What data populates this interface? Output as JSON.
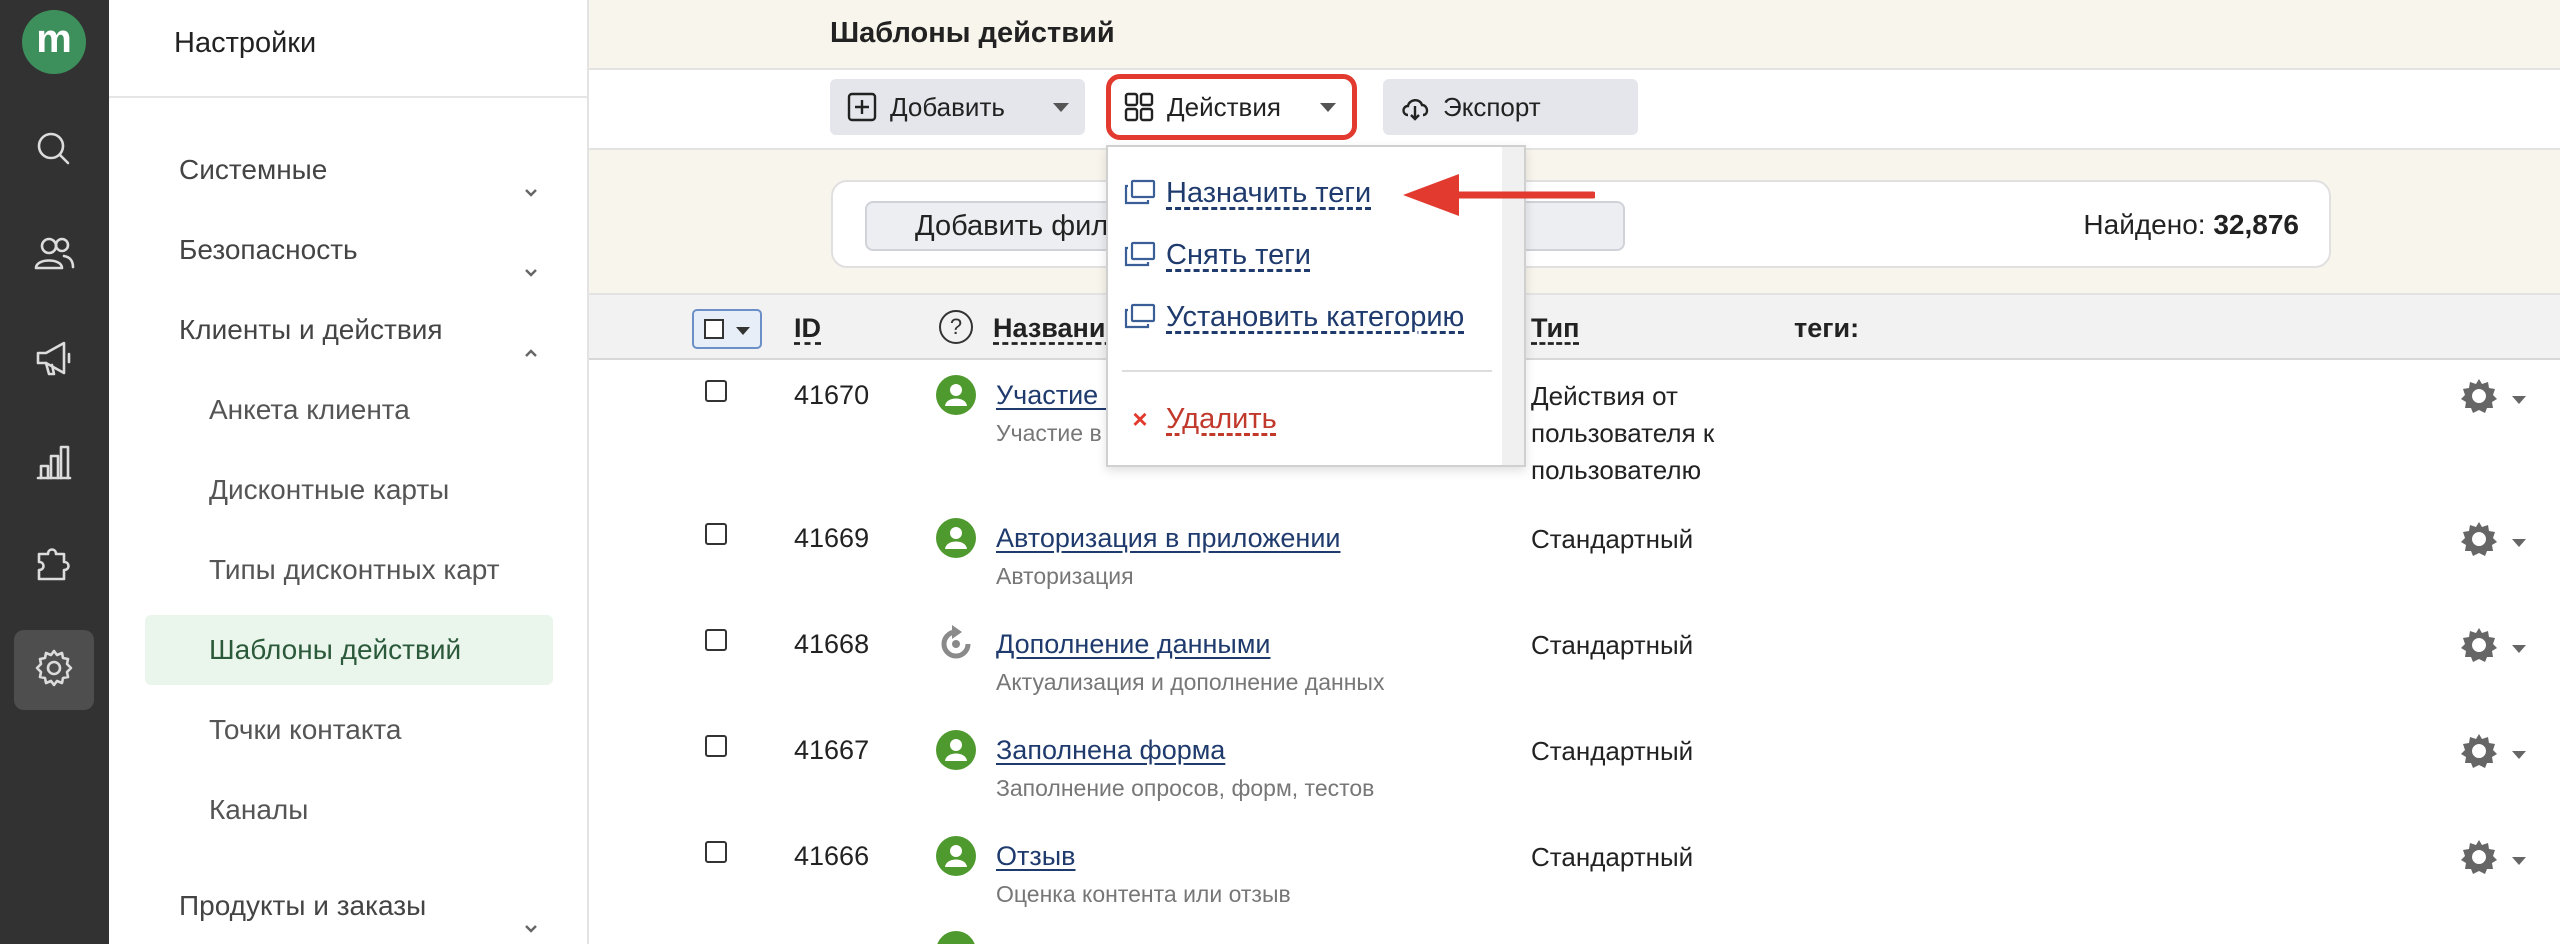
{
  "rail": {
    "logo": "m",
    "items": [
      "search-icon",
      "users-icon",
      "megaphone-icon",
      "chart-icon",
      "puzzle-icon",
      "gear-icon"
    ]
  },
  "sidebar": {
    "title": "Настройки",
    "groups": [
      {
        "label": "Системные",
        "expanded": false
      },
      {
        "label": "Безопасность",
        "expanded": false
      },
      {
        "label": "Клиенты и действия",
        "expanded": true
      }
    ],
    "subitems": [
      {
        "label": "Анкета клиента"
      },
      {
        "label": "Дисконтные карты"
      },
      {
        "label": "Типы дисконтных карт"
      },
      {
        "label": "Шаблоны действий",
        "active": true
      },
      {
        "label": "Точки контакта"
      },
      {
        "label": "Каналы"
      }
    ],
    "bottom_group": {
      "label": "Продукты и заказы",
      "expanded": false
    }
  },
  "header": {
    "title": "Шаблоны действий"
  },
  "toolbar": {
    "add_label": "Добавить",
    "actions_label": "Действия",
    "export_label": "Экспорт"
  },
  "filter": {
    "button_label": "Добавить фильтр                                              ИЛИ",
    "found_label": "Найдено:",
    "found_count": "32,876"
  },
  "table": {
    "headers": {
      "id": "ID",
      "help": "?",
      "name": "Название",
      "type": "Тип",
      "tags": "теги:"
    },
    "rows": [
      {
        "id": "41670",
        "icon": "user-icon",
        "name": "Участие в",
        "desc": "Участие в",
        "type": "Действия от пользователя к пользователю"
      },
      {
        "id": "41669",
        "icon": "user-icon",
        "name": "Авторизация в приложении",
        "desc": "Авторизация",
        "type": "Стандартный"
      },
      {
        "id": "41668",
        "icon": "refresh-icon",
        "name": "Дополнение данными",
        "desc": "Актуализация и дополнение данных",
        "type": "Стандартный"
      },
      {
        "id": "41667",
        "icon": "user-icon",
        "name": "Заполнена форма",
        "desc": "Заполнение опросов, форм, тестов",
        "type": "Стандартный"
      },
      {
        "id": "41666",
        "icon": "user-icon",
        "name": "Отзыв",
        "desc": "Оценка контента или отзыв",
        "type": "Стандартный"
      }
    ]
  },
  "actions_menu": {
    "items": [
      {
        "label": "Назначить теги",
        "icon": "copy-icon"
      },
      {
        "label": "Снять теги",
        "icon": "copy-icon"
      },
      {
        "label": "Установить категорию",
        "icon": "copy-icon"
      }
    ],
    "delete_label": "Удалить",
    "delete_mark": "×"
  },
  "colors": {
    "accent_green": "#3d8f5c",
    "highlight_red": "#e23a2e",
    "link_blue": "#1f3b6e",
    "rail_bg": "#323232",
    "header_bg": "#f8f5ec"
  }
}
